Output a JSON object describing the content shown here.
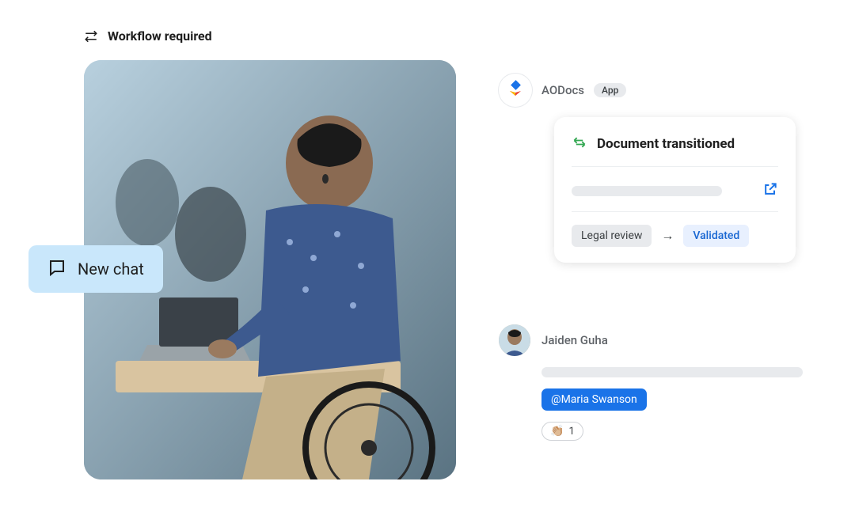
{
  "workflow": {
    "label": "Workflow required"
  },
  "new_chat": {
    "label": "New chat"
  },
  "aodocs": {
    "name": "AODocs",
    "badge": "App"
  },
  "doc_card": {
    "title": "Document transitioned",
    "from_state": "Legal review",
    "to_state": "Validated"
  },
  "message": {
    "username": "Jaiden Guha",
    "mention": "@Maria Swanson",
    "reaction_emoji": "👏🏼",
    "reaction_count": "1"
  }
}
